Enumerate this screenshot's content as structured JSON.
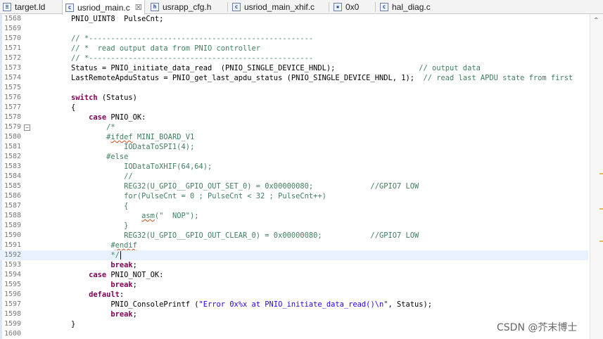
{
  "tabs": [
    {
      "label": "target.ld",
      "icon": "linker-file-icon",
      "active": false
    },
    {
      "label": "usriod_main.c",
      "icon": "c-file-icon",
      "active": true,
      "close": "☒"
    },
    {
      "label": "usrapp_cfg.h",
      "icon": "header-file-icon",
      "active": false
    },
    {
      "label": "usriod_main_xhif.c",
      "icon": "c-file-icon",
      "active": false
    },
    {
      "label": "0x0",
      "icon": "memory-view-icon",
      "active": false
    },
    {
      "label": "hal_diag.c",
      "icon": "c-file-icon",
      "active": false
    }
  ],
  "editor": {
    "lines": [
      {
        "n": "1568",
        "segs": [
          [
            "",
            "        PNIO_UINT8  PulseCnt;"
          ]
        ]
      },
      {
        "n": "1569",
        "segs": [
          [
            "",
            ""
          ]
        ]
      },
      {
        "n": "1570",
        "segs": [
          [
            "cm",
            "        // *---------------------------------------------------"
          ]
        ]
      },
      {
        "n": "1571",
        "segs": [
          [
            "cm",
            "        // *  read output data from PNIO controller"
          ]
        ]
      },
      {
        "n": "1572",
        "segs": [
          [
            "cm",
            "        // *---------------------------------------------------"
          ]
        ]
      },
      {
        "n": "1573",
        "segs": [
          [
            "",
            "        Status = PNIO_initiate_data_read  (PNIO_SINGLE_DEVICE_HNDL);                   "
          ],
          [
            "cm",
            "// output data"
          ]
        ]
      },
      {
        "n": "1574",
        "segs": [
          [
            "",
            "        LastRemoteApduStatus = PNIO_get_last_apdu_status (PNIO_SINGLE_DEVICE_HNDL, 1);  "
          ],
          [
            "cm",
            "// read last APDU state from first"
          ]
        ]
      },
      {
        "n": "1575",
        "segs": [
          [
            "",
            ""
          ]
        ]
      },
      {
        "n": "1576",
        "segs": [
          [
            "",
            "        "
          ],
          [
            "kw",
            "switch"
          ],
          [
            "",
            " (Status)"
          ]
        ]
      },
      {
        "n": "1577",
        "segs": [
          [
            "",
            "        {"
          ]
        ]
      },
      {
        "n": "1578",
        "segs": [
          [
            "",
            "            "
          ],
          [
            "kw",
            "case"
          ],
          [
            "",
            " PNIO_OK:"
          ]
        ]
      },
      {
        "n": "1579",
        "fold": "−",
        "segs": [
          [
            "cm",
            "                /*"
          ]
        ]
      },
      {
        "n": "1580",
        "segs": [
          [
            "cm",
            "                #"
          ],
          [
            "cm err",
            "ifdef"
          ],
          [
            "cm",
            " MINI_BOARD_V1"
          ]
        ]
      },
      {
        "n": "1581",
        "segs": [
          [
            "cm",
            "                    IODataToSPI1(4);"
          ]
        ]
      },
      {
        "n": "1582",
        "segs": [
          [
            "cm",
            "                #else"
          ]
        ]
      },
      {
        "n": "1583",
        "segs": [
          [
            "cm",
            "                    IODataToXHIF(64,64);"
          ]
        ]
      },
      {
        "n": "1584",
        "segs": [
          [
            "cm",
            "                    //"
          ]
        ]
      },
      {
        "n": "1585",
        "segs": [
          [
            "cm",
            "                    REG32(U_GPIO__GPIO_OUT_SET_0) = 0x00000080;             //GPIO7 LOW"
          ]
        ]
      },
      {
        "n": "1586",
        "segs": [
          [
            "cm",
            "                    for(PulseCnt = 0 ; PulseCnt < 32 ; PulseCnt++)"
          ]
        ]
      },
      {
        "n": "1587",
        "segs": [
          [
            "cm",
            "                    {"
          ]
        ]
      },
      {
        "n": "1588",
        "segs": [
          [
            "cm",
            "                        "
          ],
          [
            "cm err",
            "asm"
          ],
          [
            "cm",
            "(\"  NOP\");"
          ]
        ]
      },
      {
        "n": "1589",
        "segs": [
          [
            "cm",
            "                    }"
          ]
        ]
      },
      {
        "n": "1590",
        "segs": [
          [
            "cm",
            "                    REG32(U_GPIO__GPIO_OUT_CLEAR_0) = 0x00000080;           //GPIO7 LOW"
          ]
        ]
      },
      {
        "n": "1591",
        "segs": [
          [
            "cm",
            "                 #"
          ],
          [
            "cm err",
            "endif"
          ]
        ]
      },
      {
        "n": "1592",
        "hl": true,
        "segs": [
          [
            "cm",
            "                 */"
          ]
        ]
      },
      {
        "n": "1593",
        "segs": [
          [
            "",
            "                 "
          ],
          [
            "kw",
            "break"
          ],
          [
            "",
            ";"
          ]
        ]
      },
      {
        "n": "1594",
        "segs": [
          [
            "",
            "            "
          ],
          [
            "kw",
            "case"
          ],
          [
            "",
            " PNIO_NOT_OK:"
          ]
        ]
      },
      {
        "n": "1595",
        "segs": [
          [
            "",
            "                 "
          ],
          [
            "kw",
            "break"
          ],
          [
            "",
            ";"
          ]
        ]
      },
      {
        "n": "1596",
        "segs": [
          [
            "",
            "            "
          ],
          [
            "kw",
            "default"
          ],
          [
            "",
            ":"
          ]
        ]
      },
      {
        "n": "1597",
        "segs": [
          [
            "",
            "                 PNIO_ConsolePrintf ("
          ],
          [
            "str",
            "\"Error 0x%x at PNIO_initiate_data_read()\\n\""
          ],
          [
            "",
            ", Status);"
          ]
        ]
      },
      {
        "n": "1598",
        "segs": [
          [
            "",
            "                 "
          ],
          [
            "kw",
            "break"
          ],
          [
            "",
            ";"
          ]
        ]
      },
      {
        "n": "1599",
        "segs": [
          [
            "",
            "        }"
          ]
        ]
      },
      {
        "n": "1600",
        "segs": [
          [
            "",
            ""
          ]
        ]
      }
    ]
  },
  "scrollbar": {
    "up_glyph": "⌃"
  },
  "colors": {
    "keyword": "#7f0055",
    "comment": "#3f7f5f",
    "string": "#2a00ff",
    "current_line": "#e8f2fe"
  },
  "watermark": "CSDN @芥末博士"
}
